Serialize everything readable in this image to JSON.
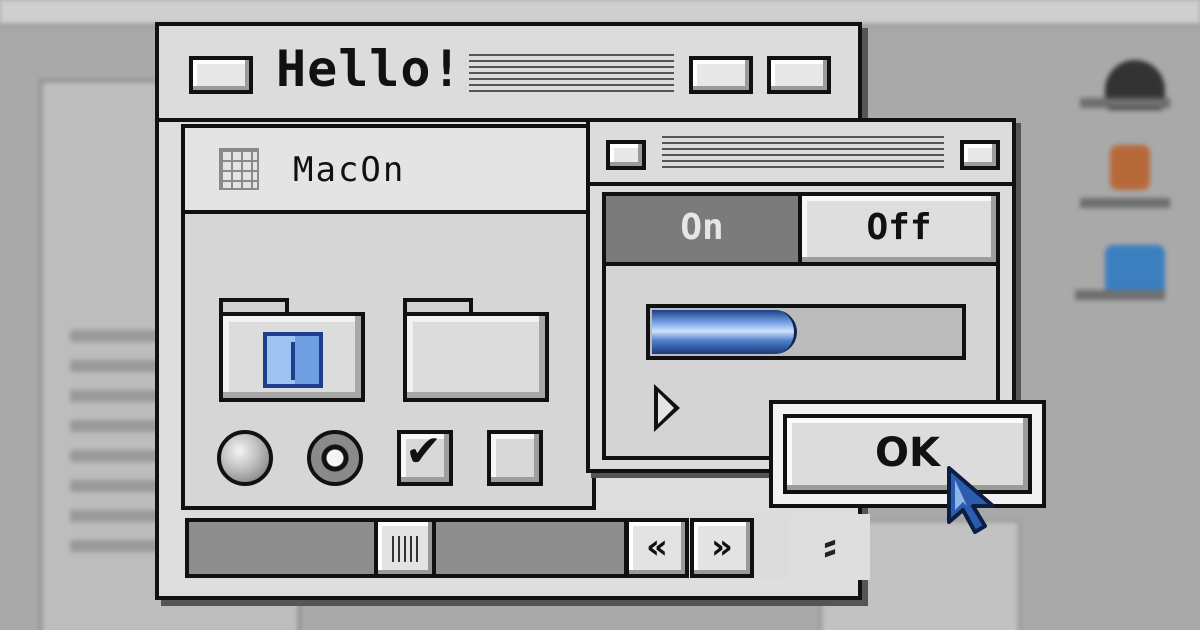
{
  "main_window": {
    "title": "Hello!",
    "panel_title": "MacOn"
  },
  "small_window": {
    "segmented": {
      "on_label": "On",
      "off_label": "Off",
      "selected": "On"
    },
    "progress": 0.47
  },
  "ok_button": {
    "label": "OK"
  },
  "scrollbar": {
    "left_arrow": "«",
    "right_arrow": "»"
  },
  "colors": {
    "chrome": "#dcdcdc",
    "border": "#111111",
    "progress_blue": "#4f7fc8",
    "background": "#a9a9a9"
  },
  "icons": [
    "folder-icon",
    "finder-icon",
    "grid-icon",
    "radio-button",
    "checkbox",
    "disclosure-triangle-icon",
    "arrow-cursor-icon",
    "grow-box-icon"
  ]
}
